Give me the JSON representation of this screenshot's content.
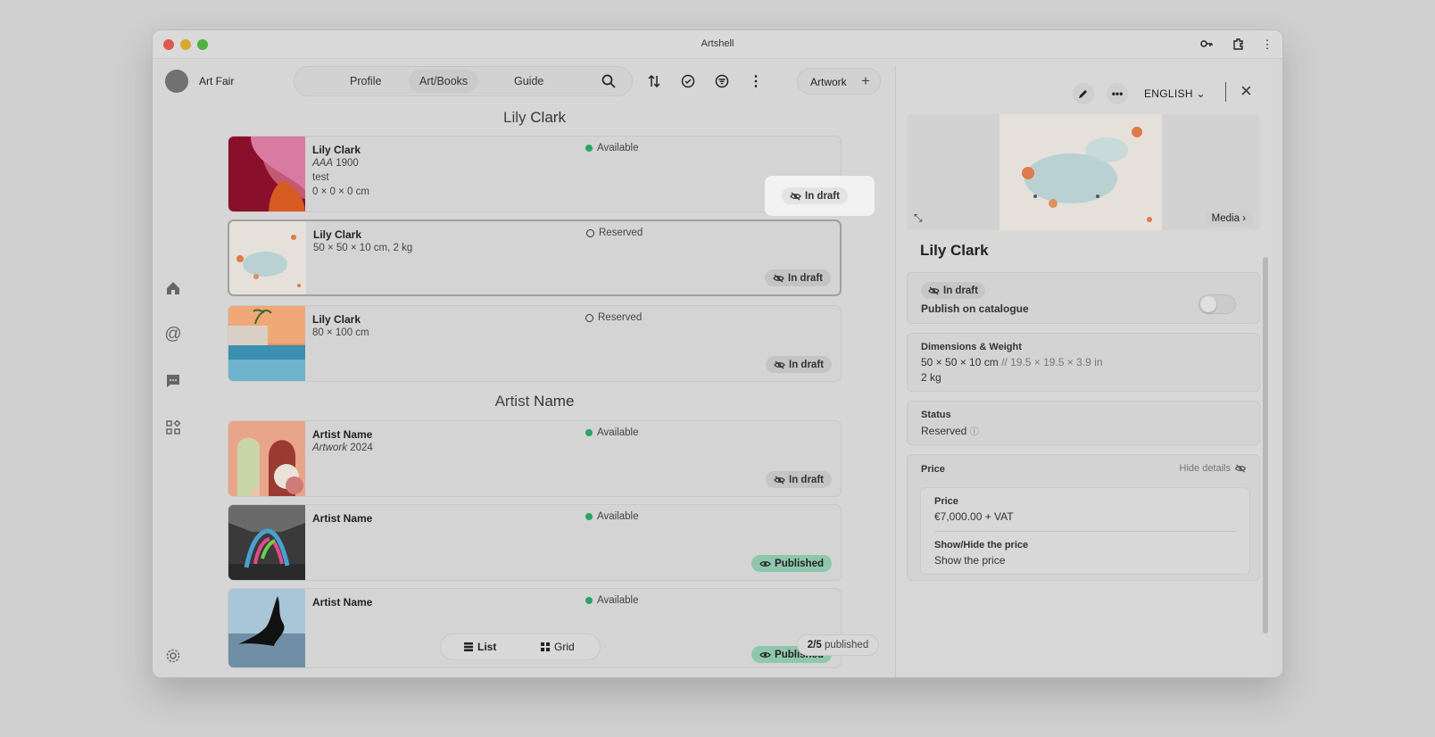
{
  "window": {
    "title": "Artshell"
  },
  "header": {
    "org_name": "Art Fair",
    "tabs": [
      "Profile",
      "Art/Books",
      "Guide"
    ],
    "active_tab": "Art/Books",
    "artwork_label": "Artwork"
  },
  "groups": [
    {
      "first": "Lily",
      "last": "Clark"
    },
    {
      "first": "Artist",
      "last": "Name"
    }
  ],
  "cards": [
    {
      "artist": "Lily Clark",
      "title_italic": "AAA",
      "year": "1900",
      "line2": "test",
      "line3": "0 × 0 × 0 cm",
      "status": "Available",
      "badge": "In draft"
    },
    {
      "artist": "Lily Clark",
      "line1": "50 × 50 × 10 cm, 2 kg",
      "status": "Reserved",
      "badge": "In draft"
    },
    {
      "artist": "Lily Clark",
      "line1": "80 × 100 cm",
      "status": "Reserved",
      "badge": "In draft"
    },
    {
      "artist": "Artist Name",
      "title_italic": "Artwork",
      "year": "2024",
      "status": "Available",
      "badge": "In draft"
    },
    {
      "artist": "Artist Name",
      "status": "Available",
      "badge": "Published"
    },
    {
      "artist": "Artist Name",
      "status": "Available",
      "badge": "Published"
    }
  ],
  "view": {
    "list": "List",
    "grid": "Grid",
    "pub_count": "2/5",
    "pub_suffix": "published"
  },
  "panel": {
    "language": "ENGLISH",
    "media_label": "Media",
    "title": "Lily Clark",
    "draft_chip": "In draft",
    "publish_label": "Publish on catalogue",
    "publish_on": false,
    "dim_label": "Dimensions & Weight",
    "dim_cm": "50 × 50 × 10 cm",
    "dim_in": "// 19.5 × 19.5 × 3.9 in",
    "weight": "2 kg",
    "status_label": "Status",
    "status_value": "Reserved",
    "price_section": "Price",
    "hide_details": "Hide details",
    "price_label": "Price",
    "price_value": "€7,000.00 + VAT",
    "showhide_label": "Show/Hide the price",
    "showhide_value": "Show the price"
  },
  "colors": {
    "available": "#2ba36a",
    "published_bg": "#8fc7ad",
    "mac_red": "#e0574f",
    "mac_yellow": "#d9a830",
    "mac_green": "#52b043"
  }
}
